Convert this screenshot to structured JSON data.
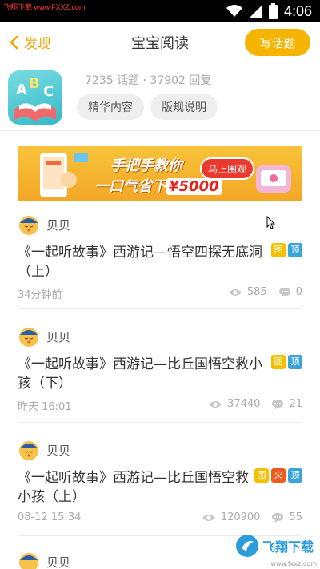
{
  "status_bar": {
    "watermark": "飞翔下载 www.FXXZ.com",
    "time": "4:06"
  },
  "header": {
    "back_label": "发现",
    "title": "宝宝阅读",
    "write_button": "写话题"
  },
  "forum": {
    "stats": "7235 话题 · 37902 回复",
    "pills": [
      "精华内容",
      "版规说明"
    ]
  },
  "banner": {
    "line1": "手把手教你",
    "line2_prefix": "一口气省下",
    "amount": "¥5000",
    "cta": "马上围观"
  },
  "posts": [
    {
      "author": "贝贝",
      "title": "《一起听故事》西游记—悟空四探无底洞（上）",
      "time": "34分钟前",
      "views": "585",
      "comments": "0",
      "badges": [
        "图",
        "顶"
      ]
    },
    {
      "author": "贝贝",
      "title": "《一起听故事》西游记—比丘国悟空救小孩（下）",
      "time": "昨天 16:01",
      "views": "37440",
      "comments": "21",
      "badges": [
        "图",
        "顶"
      ]
    },
    {
      "author": "贝贝",
      "title": "《一起听故事》西游记—比丘国悟空救小孩（上）",
      "time": "08-12 15:34",
      "views": "120900",
      "comments": "55",
      "badges": [
        "图",
        "火",
        "顶"
      ]
    },
    {
      "author": "贝贝"
    }
  ],
  "watermark_bottom": {
    "brand": "飞翔下载",
    "url": "www.fxxz.com"
  },
  "colors": {
    "accent": "#f5b400",
    "badge_tu": "#f5c000",
    "badge_ding": "#3aa3d8",
    "badge_huo": "#ef5b1f"
  }
}
